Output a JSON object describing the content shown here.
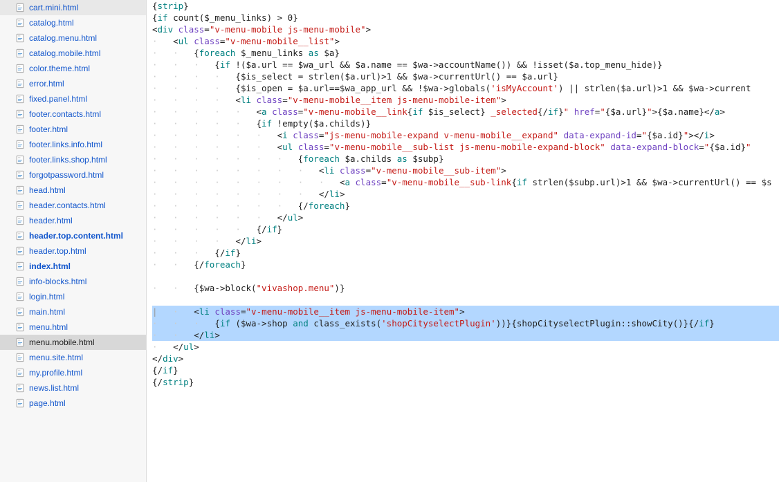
{
  "sidebar": {
    "files": [
      {
        "name": "cart.mini.html",
        "selected": false,
        "bold": false
      },
      {
        "name": "catalog.html",
        "selected": false,
        "bold": false
      },
      {
        "name": "catalog.menu.html",
        "selected": false,
        "bold": false
      },
      {
        "name": "catalog.mobile.html",
        "selected": false,
        "bold": false
      },
      {
        "name": "color.theme.html",
        "selected": false,
        "bold": false
      },
      {
        "name": "error.html",
        "selected": false,
        "bold": false
      },
      {
        "name": "fixed.panel.html",
        "selected": false,
        "bold": false
      },
      {
        "name": "footer.contacts.html",
        "selected": false,
        "bold": false
      },
      {
        "name": "footer.html",
        "selected": false,
        "bold": false
      },
      {
        "name": "footer.links.info.html",
        "selected": false,
        "bold": false
      },
      {
        "name": "footer.links.shop.html",
        "selected": false,
        "bold": false
      },
      {
        "name": "forgotpassword.html",
        "selected": false,
        "bold": false
      },
      {
        "name": "head.html",
        "selected": false,
        "bold": false
      },
      {
        "name": "header.contacts.html",
        "selected": false,
        "bold": false
      },
      {
        "name": "header.html",
        "selected": false,
        "bold": false
      },
      {
        "name": "header.top.content.html",
        "selected": false,
        "bold": true
      },
      {
        "name": "header.top.html",
        "selected": false,
        "bold": false
      },
      {
        "name": "index.html",
        "selected": false,
        "bold": true
      },
      {
        "name": "info-blocks.html",
        "selected": false,
        "bold": false
      },
      {
        "name": "login.html",
        "selected": false,
        "bold": false
      },
      {
        "name": "main.html",
        "selected": false,
        "bold": false
      },
      {
        "name": "menu.html",
        "selected": false,
        "bold": false
      },
      {
        "name": "menu.mobile.html",
        "selected": true,
        "bold": false
      },
      {
        "name": "menu.site.html",
        "selected": false,
        "bold": false
      },
      {
        "name": "my.profile.html",
        "selected": false,
        "bold": false
      },
      {
        "name": "news.list.html",
        "selected": false,
        "bold": false
      },
      {
        "name": "page.html",
        "selected": false,
        "bold": false
      }
    ]
  },
  "code": {
    "lines": [
      {
        "html": "{<span class='tok-kw'>strip</span>}"
      },
      {
        "html": "{<span class='tok-kw'>if</span> count($_menu_links) &gt; 0}"
      },
      {
        "html": "&lt;<span class='tok-tag'>div</span> <span class='tok-attr'>class</span>=<span class='tok-str'>\"v-menu-mobile js-menu-mobile\"</span>&gt;"
      },
      {
        "html": "<span class='indent-guide'>·   </span>&lt;<span class='tok-tag'>ul</span> <span class='tok-attr'>class</span>=<span class='tok-str'>\"v-menu-mobile__list\"</span>&gt;"
      },
      {
        "html": "<span class='indent-guide'>·   ·   </span>{<span class='tok-kw'>foreach</span> $_menu_links <span class='tok-kw'>as</span> $a}"
      },
      {
        "html": "<span class='indent-guide'>·   ·   ·   </span>{<span class='tok-kw'>if</span> !($a.url == $wa_url &amp;&amp; $a.name == $wa-&gt;accountName()) &amp;&amp; !isset($a.top_menu_hide)}"
      },
      {
        "html": "<span class='indent-guide'>·   ·   ·   ·   </span>{$is_select = strlen($a.url)&gt;1 &amp;&amp; $wa-&gt;currentUrl() == $a.url}"
      },
      {
        "html": "<span class='indent-guide'>·   ·   ·   ·   </span>{$is_open = $a.url==$wa_app_url &amp;&amp; !$wa-&gt;globals(<span class='tok-str'>'isMyAccount'</span>) || strlen($a.url)&gt;1 &amp;&amp; $wa-&gt;current"
      },
      {
        "html": "<span class='indent-guide'>·   ·   ·   ·   </span>&lt;<span class='tok-tag'>li</span> <span class='tok-attr'>class</span>=<span class='tok-str'>\"v-menu-mobile__item js-menu-mobile-item\"</span>&gt;"
      },
      {
        "html": "<span class='indent-guide'>·   ·   ·   ·   ·   </span>&lt;<span class='tok-tag'>a</span> <span class='tok-attr'>class</span>=<span class='tok-str'>\"v-menu-mobile__link</span>{<span class='tok-kw'>if</span> $is_select}<span class='tok-str'> _selected</span>{/<span class='tok-kw'>if</span>}<span class='tok-str'>\"</span> <span class='tok-attr'>href</span>=<span class='tok-str'>\"</span>{$a.url}<span class='tok-str'>\"</span>&gt;{$a.name}&lt;/<span class='tok-tag'>a</span>&gt;"
      },
      {
        "html": "<span class='indent-guide'>·   ·   ·   ·   ·   </span>{<span class='tok-kw'>if</span> !empty($a.childs)}"
      },
      {
        "html": "<span class='indent-guide'>·   ·   ·   ·   ·   ·   </span>&lt;<span class='tok-tag'>i</span> <span class='tok-attr'>class</span>=<span class='tok-str'>\"js-menu-mobile-expand v-menu-mobile__expand\"</span> <span class='tok-attr'>data-expand-id</span>=<span class='tok-str'>\"</span>{$a.id}<span class='tok-str'>\"</span>&gt;&lt;/<span class='tok-tag'>i</span>&gt;"
      },
      {
        "html": "<span class='indent-guide'>·   ·   ·   ·   ·   ·   </span>&lt;<span class='tok-tag'>ul</span> <span class='tok-attr'>class</span>=<span class='tok-str'>\"v-menu-mobile__sub-list js-menu-mobile-expand-block\"</span> <span class='tok-attr'>data-expand-block</span>=<span class='tok-str'>\"</span>{$a.id}<span class='tok-str'>\"</span>"
      },
      {
        "html": "<span class='indent-guide'>·   ·   ·   ·   ·   ·   ·   </span>{<span class='tok-kw'>foreach</span> $a.childs <span class='tok-kw'>as</span> $subp}"
      },
      {
        "html": "<span class='indent-guide'>·   ·   ·   ·   ·   ·   ·   ·   </span>&lt;<span class='tok-tag'>li</span> <span class='tok-attr'>class</span>=<span class='tok-str'>\"v-menu-mobile__sub-item\"</span>&gt;"
      },
      {
        "html": "<span class='indent-guide'>·   ·   ·   ·   ·   ·   ·   ·   ·   </span>&lt;<span class='tok-tag'>a</span> <span class='tok-attr'>class</span>=<span class='tok-str'>\"v-menu-mobile__sub-link</span>{<span class='tok-kw'>if</span> strlen($subp.url)&gt;1 &amp;&amp; $wa-&gt;currentUrl() == $s"
      },
      {
        "html": "<span class='indent-guide'>·   ·   ·   ·   ·   ·   ·   ·   </span>&lt;/<span class='tok-tag'>li</span>&gt;"
      },
      {
        "html": "<span class='indent-guide'>·   ·   ·   ·   ·   ·   ·   </span>{/<span class='tok-kw'>foreach</span>}"
      },
      {
        "html": "<span class='indent-guide'>·   ·   ·   ·   ·   ·   </span>&lt;/<span class='tok-tag'>ul</span>&gt;"
      },
      {
        "html": "<span class='indent-guide'>·   ·   ·   ·   ·   </span>{/<span class='tok-kw'>if</span>}"
      },
      {
        "html": "<span class='indent-guide'>·   ·   ·   ·   </span>&lt;/<span class='tok-tag'>li</span>&gt;"
      },
      {
        "html": "<span class='indent-guide'>·   ·   ·   </span>{/<span class='tok-kw'>if</span>}"
      },
      {
        "html": "<span class='indent-guide'>·   ·   </span>{/<span class='tok-kw'>foreach</span>}"
      },
      {
        "html": ""
      },
      {
        "html": "<span class='indent-guide'>·   ·   </span>{$wa-&gt;block(<span class='tok-str'>\"vivashop.menu\"</span>)}"
      },
      {
        "html": ""
      },
      {
        "html": "<span class='gutter-cursor'>|</span><span class='indent-guide'>   ·   </span>&lt;<span class='tok-tag'>li</span> <span class='tok-attr'>class</span>=<span class='tok-str'>\"v-menu-mobile__item js-menu-mobile-item\"</span>&gt;",
        "hl": true
      },
      {
        "html": "<span class='indent-guide'>·   ·   ·   </span>{<span class='tok-kw'>if</span> ($wa-&gt;shop <span class='tok-kw'>and</span> class_exists(<span class='tok-str'>'shopCityselectPlugin'</span>))}{shopCityselectPlugin::showCity()}{/<span class='tok-kw'>if</span>}",
        "hl": true
      },
      {
        "html": "<span class='indent-guide'>·   ·   </span>&lt;/<span class='tok-tag'>li</span>&gt;",
        "hl": true
      },
      {
        "html": "<span class='indent-guide'>·   </span>&lt;/<span class='tok-tag'>ul</span>&gt;"
      },
      {
        "html": "&lt;/<span class='tok-tag'>div</span>&gt;"
      },
      {
        "html": "{/<span class='tok-kw'>if</span>}"
      },
      {
        "html": "{/<span class='tok-kw'>strip</span>}"
      }
    ]
  }
}
